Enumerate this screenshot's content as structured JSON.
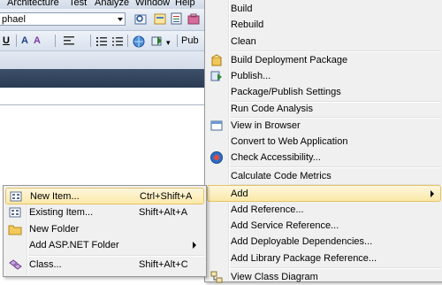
{
  "ide": {
    "menubar": [
      "Architecture",
      "Test",
      "Analyze",
      "Window",
      "Help"
    ],
    "toolbar_combo_value": "phael",
    "format_toolbar_text": "Pub"
  },
  "project_menu": {
    "items": [
      {
        "label": "Build",
        "icon": "none"
      },
      {
        "label": "Rebuild",
        "icon": "none"
      },
      {
        "label": "Clean",
        "icon": "none"
      },
      {
        "label": "Build Deployment Package",
        "icon": "package-icon"
      },
      {
        "label": "Publish...",
        "icon": "publish-icon"
      },
      {
        "label": "Package/Publish Settings",
        "icon": "none"
      },
      {
        "label": "Run Code Analysis",
        "icon": "none"
      },
      {
        "label": "View in Browser",
        "icon": "browser-icon"
      },
      {
        "label": "Convert to Web Application",
        "icon": "none"
      },
      {
        "label": "Check Accessibility...",
        "icon": "accessibility-icon"
      },
      {
        "label": "Calculate Code Metrics",
        "icon": "none"
      },
      {
        "label": "Add",
        "icon": "none",
        "submenu": true,
        "highlighted": true
      },
      {
        "label": "Add Reference...",
        "icon": "none"
      },
      {
        "label": "Add Service Reference...",
        "icon": "none"
      },
      {
        "label": "Add Deployable Dependencies...",
        "icon": "none"
      },
      {
        "label": "Add Library Package Reference...",
        "icon": "none"
      },
      {
        "label": "View Class Diagram",
        "icon": "class-diagram-icon"
      }
    ]
  },
  "add_submenu": {
    "items": [
      {
        "label": "New Item...",
        "shortcut": "Ctrl+Shift+A",
        "icon": "new-item-icon",
        "highlighted": true
      },
      {
        "label": "Existing Item...",
        "shortcut": "Shift+Alt+A",
        "icon": "existing-item-icon"
      },
      {
        "label": "New Folder",
        "shortcut": "",
        "icon": "folder-icon"
      },
      {
        "label": "Add ASP.NET Folder",
        "shortcut": "",
        "icon": "none",
        "submenu": true
      },
      {
        "label": "Class...",
        "shortcut": "Shift+Alt+C",
        "icon": "class-icon"
      }
    ]
  },
  "colors": {
    "highlight_top": "#fdf6dd",
    "highlight_bottom": "#fbe9a8",
    "highlight_border": "#e5c365",
    "menu_bg": "#f0f0f0",
    "dark_bar": "#2b3b53"
  }
}
